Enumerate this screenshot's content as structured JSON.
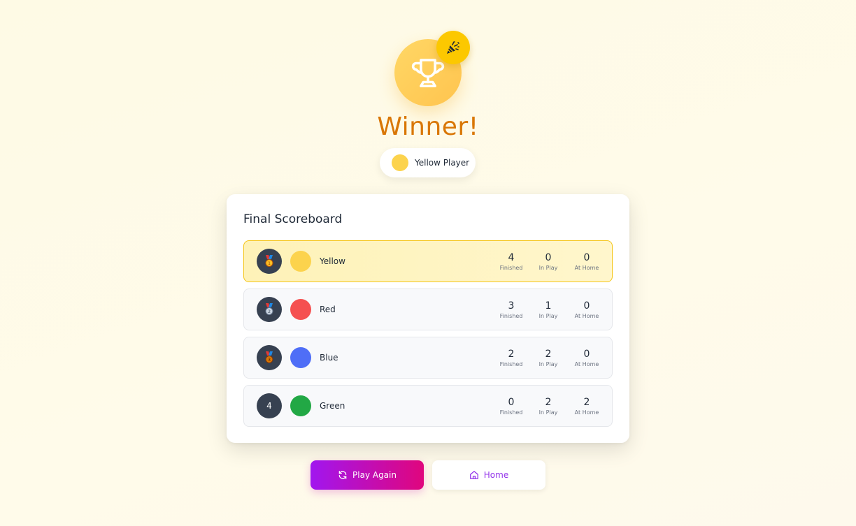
{
  "winner": {
    "title": "Winner!",
    "player_name": "Yellow Player",
    "player_color": "#fcd34d"
  },
  "scoreboard": {
    "title": "Final Scoreboard",
    "stat_labels": {
      "finished": "Finished",
      "in_play": "In Play",
      "at_home": "At Home"
    },
    "rows": [
      {
        "rank_icon": "gold-medal-icon",
        "rank": "",
        "name": "Yellow",
        "color": "#fcd34d",
        "finished": "4",
        "in_play": "0",
        "at_home": "0"
      },
      {
        "rank_icon": "silver-medal-icon",
        "rank": "",
        "name": "Red",
        "color": "#f55050",
        "finished": "3",
        "in_play": "1",
        "at_home": "0"
      },
      {
        "rank_icon": "bronze-medal-icon",
        "rank": "",
        "name": "Blue",
        "color": "#4f6ef7",
        "finished": "2",
        "in_play": "2",
        "at_home": "0"
      },
      {
        "rank_icon": "",
        "rank": "4",
        "name": "Green",
        "color": "#22a845",
        "finished": "0",
        "in_play": "2",
        "at_home": "2"
      }
    ]
  },
  "actions": {
    "play_again_label": "Play Again",
    "home_label": "Home"
  },
  "colors": {
    "accent_gold": "#d97706",
    "highlight_border": "#f5c518",
    "play_gradient_start": "#a116ef",
    "play_gradient_end": "#e0067d",
    "home_text": "#9333ea"
  }
}
